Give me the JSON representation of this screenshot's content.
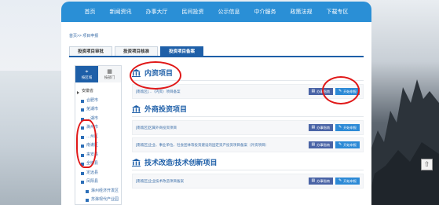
{
  "nav": [
    "首页",
    "新闻资讯",
    "办事大厅",
    "民间投资",
    "公示信息",
    "中介服务",
    "政策法规",
    "下载专区"
  ],
  "breadcrumb": "首页>> 项目申报",
  "tabs": [
    "投资项目审批",
    "投资项目核准",
    "投资项目备案"
  ],
  "active_tab": "投资项目备案",
  "sidebar": {
    "buttons": [
      {
        "label": "按区域",
        "icon": "map-pin-icon"
      },
      {
        "label": "按部门",
        "icon": "org-icon"
      }
    ],
    "items": [
      {
        "label": "安徽省",
        "level": "root"
      },
      {
        "label": "合肥市",
        "level": "1"
      },
      {
        "label": "芜湖市",
        "level": "1"
      },
      {
        "label": "…湖市",
        "level": "1"
      },
      {
        "label": "滁州市",
        "level": "1"
      },
      {
        "label": "…州区",
        "level": "1"
      },
      {
        "label": "南谯区",
        "level": "1"
      },
      {
        "label": "来安县",
        "level": "1"
      },
      {
        "label": "全椒县",
        "level": "1"
      },
      {
        "label": "定远县",
        "level": "1"
      },
      {
        "label": "凤阳县",
        "level": "1"
      },
      {
        "label": "滁州经济开发区",
        "level": "2"
      },
      {
        "label": "苏滁现代产业园",
        "level": "2"
      }
    ]
  },
  "sections": [
    {
      "title": "内资项目",
      "rows": [
        {
          "text": "[南谯区]…（内资）项目备案",
          "guide": "办事指南",
          "start": "开始申报"
        }
      ]
    },
    {
      "title": "外商投资项目",
      "rows": [
        {
          "text": "[南谯区]区属外商投资项目",
          "guide": "办事指南",
          "start": "开始申报"
        },
        {
          "text": "[南谯区]企业、事业单位、社会团体等投资建设的固定资产投资项目备案（外资项目）",
          "guide": "办事指南",
          "start": "开始申报"
        }
      ]
    },
    {
      "title": "技术改造/技术创新项目",
      "rows": [
        {
          "text": "[南谯区]企业技术改造项目备案",
          "guide": "办事指南",
          "start": "开始申报"
        }
      ]
    }
  ],
  "colors": {
    "nav": "#2a8fd6",
    "brand": "#1e5fa8",
    "annotation": "#e01818"
  }
}
